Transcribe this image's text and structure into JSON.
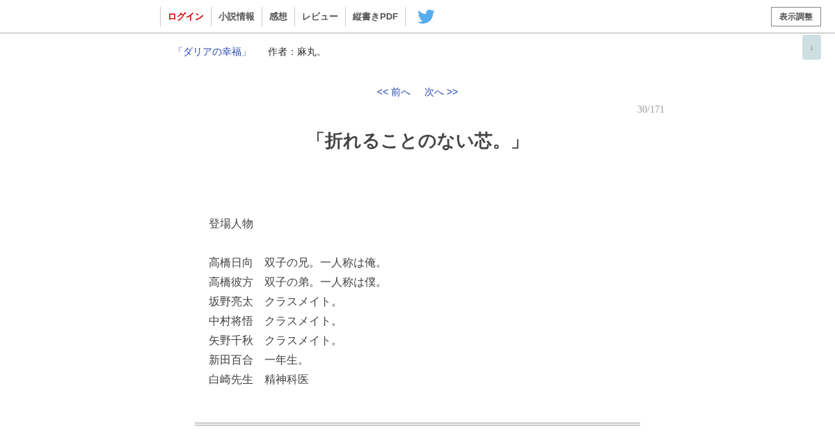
{
  "header": {
    "nav": [
      {
        "label": "ログイン",
        "kind": "login"
      },
      {
        "label": "小説情報",
        "kind": "link"
      },
      {
        "label": "感想",
        "kind": "link"
      },
      {
        "label": "レビュー",
        "kind": "link"
      },
      {
        "label": "縦書きPDF",
        "kind": "link"
      }
    ],
    "display_button": "表示調整",
    "scroll_button": "↓"
  },
  "work": {
    "title": "「ダリアの幸福」",
    "author": "作者：麻丸。"
  },
  "pager": {
    "prev": "<< 前へ",
    "next": "次へ >>",
    "count": "30/171"
  },
  "chapter_title": "「折れることのない芯。」",
  "body": {
    "heading": "登場人物",
    "characters": [
      {
        "name": "高橋日向",
        "note": "双子の兄。一人称は俺。"
      },
      {
        "name": "高橋彼方",
        "note": "双子の弟。一人称は僕。"
      },
      {
        "name": "坂野亮太",
        "note": "クラスメイト。"
      },
      {
        "name": "中村将悟",
        "note": "クラスメイト。"
      },
      {
        "name": "矢野千秋",
        "note": "クラスメイト。"
      },
      {
        "name": "新田百合",
        "note": "一年生。"
      },
      {
        "name": "白崎先生",
        "note": "精神科医"
      }
    ]
  }
}
